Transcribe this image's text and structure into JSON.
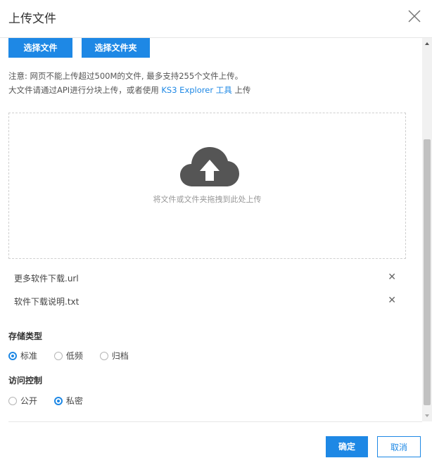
{
  "dialog": {
    "title": "上传文件"
  },
  "toolbar": {
    "select_file_label": "选择文件",
    "select_folder_label": "选择文件夹"
  },
  "notice": {
    "line1": "注意: 网页不能上传超过500M的文件, 最多支持255个文件上传。",
    "line2_prefix": "大文件请通过API进行分块上传，或者使用 ",
    "line2_link": "KS3 Explorer 工具",
    "line2_suffix": " 上传"
  },
  "dropzone": {
    "text": "将文件或文件夹拖拽到此处上传",
    "icon": "cloud-upload-icon"
  },
  "files": [
    {
      "name": "更多软件下载.url"
    },
    {
      "name": "软件下载说明.txt"
    }
  ],
  "storage": {
    "label": "存储类型",
    "options": [
      {
        "label": "标准",
        "checked": true
      },
      {
        "label": "低频",
        "checked": false
      },
      {
        "label": "归档",
        "checked": false
      }
    ]
  },
  "access": {
    "label": "访问控制",
    "options": [
      {
        "label": "公开",
        "checked": false
      },
      {
        "label": "私密",
        "checked": true
      }
    ]
  },
  "footer": {
    "confirm_label": "确定",
    "cancel_label": "取消"
  },
  "colors": {
    "accent": "#1e88e5",
    "cloud": "#555555"
  }
}
